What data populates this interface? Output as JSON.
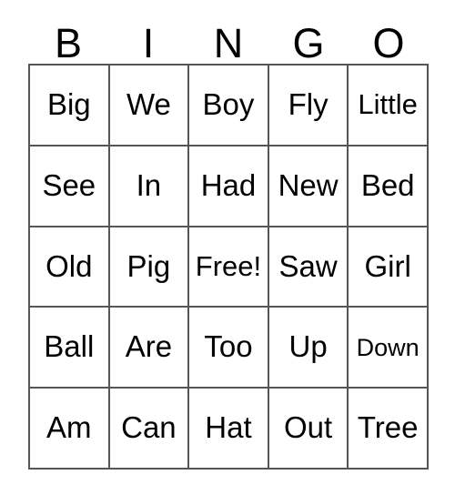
{
  "card": {
    "title": "BINGO",
    "header_letters": [
      "B",
      "I",
      "N",
      "G",
      "O"
    ],
    "rows": [
      [
        {
          "text": "Big",
          "size": "normal",
          "free": false
        },
        {
          "text": "We",
          "size": "normal",
          "free": false
        },
        {
          "text": "Boy",
          "size": "normal",
          "free": false
        },
        {
          "text": "Fly",
          "size": "normal",
          "free": false
        },
        {
          "text": "Little",
          "size": "med",
          "free": false
        }
      ],
      [
        {
          "text": "See",
          "size": "normal",
          "free": false
        },
        {
          "text": "In",
          "size": "normal",
          "free": false
        },
        {
          "text": "Had",
          "size": "normal",
          "free": false
        },
        {
          "text": "New",
          "size": "normal",
          "free": false
        },
        {
          "text": "Bed",
          "size": "normal",
          "free": false
        }
      ],
      [
        {
          "text": "Old",
          "size": "normal",
          "free": false
        },
        {
          "text": "Pig",
          "size": "normal",
          "free": false
        },
        {
          "text": "Free!",
          "size": "med",
          "free": true
        },
        {
          "text": "Saw",
          "size": "normal",
          "free": false
        },
        {
          "text": "Girl",
          "size": "normal",
          "free": false
        }
      ],
      [
        {
          "text": "Ball",
          "size": "normal",
          "free": false
        },
        {
          "text": "Are",
          "size": "normal",
          "free": false
        },
        {
          "text": "Too",
          "size": "normal",
          "free": false
        },
        {
          "text": "Up",
          "size": "normal",
          "free": false
        },
        {
          "text": "Down",
          "size": "long",
          "free": false
        }
      ],
      [
        {
          "text": "Am",
          "size": "normal",
          "free": false
        },
        {
          "text": "Can",
          "size": "normal",
          "free": false
        },
        {
          "text": "Hat",
          "size": "normal",
          "free": false
        },
        {
          "text": "Out",
          "size": "normal",
          "free": false
        },
        {
          "text": "Tree",
          "size": "normal",
          "free": false
        }
      ]
    ],
    "colors": {
      "background": "#ffffff",
      "text": "#000000",
      "grid_line": "#555555"
    }
  }
}
